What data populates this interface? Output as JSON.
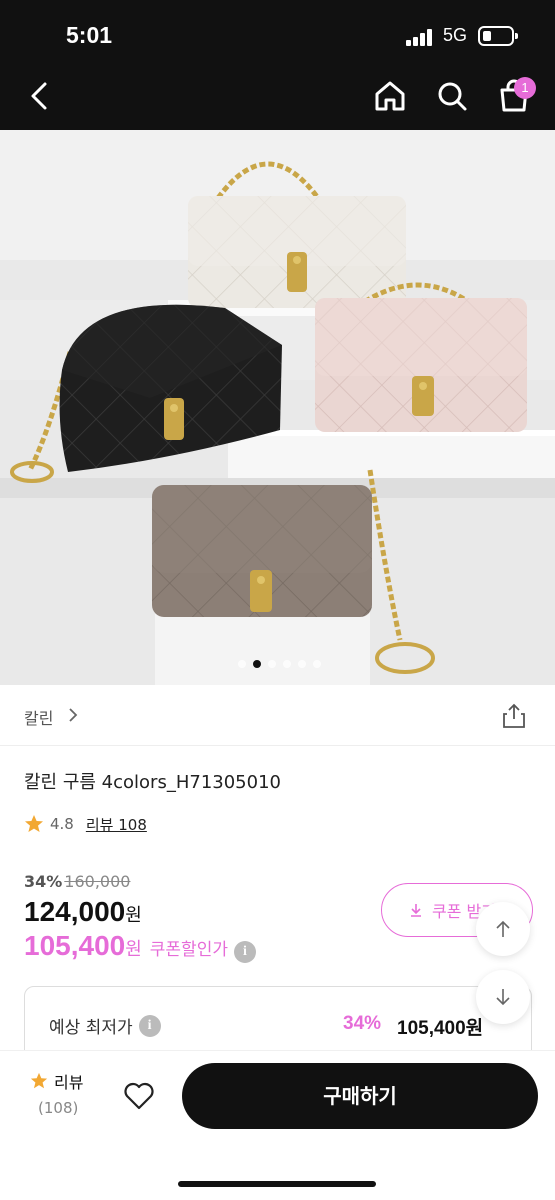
{
  "status_bar": {
    "time": "5:01",
    "network": "5G"
  },
  "nav": {
    "cart_count": "1"
  },
  "carousel": {
    "total": 6,
    "active_index": 1
  },
  "brand": {
    "name": "칼린"
  },
  "product": {
    "title": "칼린 구름 4colors_H71305010",
    "rating": "4.8",
    "review_label": "리뷰 108"
  },
  "pricing": {
    "discount_rate": "34%",
    "original_price": "160,000",
    "sale_price": "124,000",
    "sale_unit": "원",
    "coupon_price": "105,400",
    "coupon_unit": "원",
    "coupon_label": "쿠폰할인가",
    "coupon_button": "쿠폰 받기"
  },
  "estimate": {
    "label": "예상 최저가",
    "rate": "34%",
    "price": "105,400원"
  },
  "bottom": {
    "review_label": "리뷰",
    "review_count": "(108)",
    "buy_label": "구매하기"
  },
  "colors": {
    "accent": "#e66cd8",
    "dark": "#111111"
  }
}
